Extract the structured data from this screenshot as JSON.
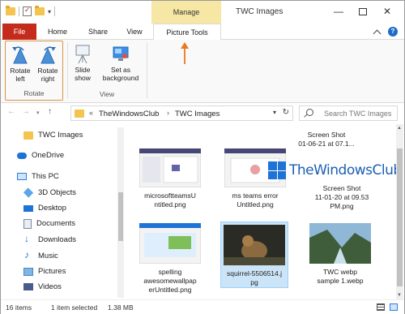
{
  "window": {
    "title": "TWC Images",
    "contextual_header": "Manage"
  },
  "tabs": {
    "file": "File",
    "home": "Home",
    "share": "Share",
    "view": "View",
    "picture_tools": "Picture Tools"
  },
  "ribbon": {
    "rotate_left_1": "Rotate",
    "rotate_left_2": "left",
    "rotate_right_1": "Rotate",
    "rotate_right_2": "right",
    "rotate_group": "Rotate",
    "slide_show_1": "Slide",
    "slide_show_2": "show",
    "set_background_1": "Set as",
    "set_background_2": "background",
    "view_group": "View"
  },
  "address": {
    "root_chevron": "«",
    "crumb1": "TheWindowsClub",
    "separator": "›",
    "crumb2": "TWC Images",
    "search_placeholder": "Search TWC Images"
  },
  "nav": [
    {
      "label": "TWC Images",
      "icon": "folder-icon"
    },
    {
      "label": "OneDrive",
      "icon": "onedrive-icon"
    },
    {
      "label": "This PC",
      "icon": "this-pc-icon"
    },
    {
      "label": "3D Objects",
      "icon": "3d-objects-icon"
    },
    {
      "label": "Desktop",
      "icon": "desktop-icon"
    },
    {
      "label": "Documents",
      "icon": "documents-icon"
    },
    {
      "label": "Downloads",
      "icon": "downloads-icon"
    },
    {
      "label": "Music",
      "icon": "music-icon"
    },
    {
      "label": "Pictures",
      "icon": "pictures-icon"
    },
    {
      "label": "Videos",
      "icon": "videos-icon"
    }
  ],
  "files": [
    {
      "name_1": "Screen Shot",
      "name_2": "01-06-21 at 07.1..."
    },
    {
      "name_1": "microsoftteamsU",
      "name_2": "ntitled.png"
    },
    {
      "name_1": "ms teams error",
      "name_2": "Untitled.png"
    },
    {
      "name_1": "Screen Shot",
      "name_2": "11-01-20 at 09.53",
      "name_3": "PM.png"
    },
    {
      "name_1": "spelling",
      "name_2": "awesomewallpap",
      "name_3": "erUntitled.png"
    },
    {
      "name_1": "squirrel-5506514.j",
      "name_2": "pg"
    },
    {
      "name_1": "TWC webp",
      "name_2": "sample 1.webp"
    }
  ],
  "status": {
    "items": "16 items",
    "selected": "1 item selected",
    "size": "1.38 MB"
  },
  "watermark": "TheWindowsClub",
  "colors": {
    "file_tab": "#c42b1c",
    "manage_header": "#f6e7a4",
    "selection": "#cce4f7",
    "accent_orange": "#e8791e"
  }
}
